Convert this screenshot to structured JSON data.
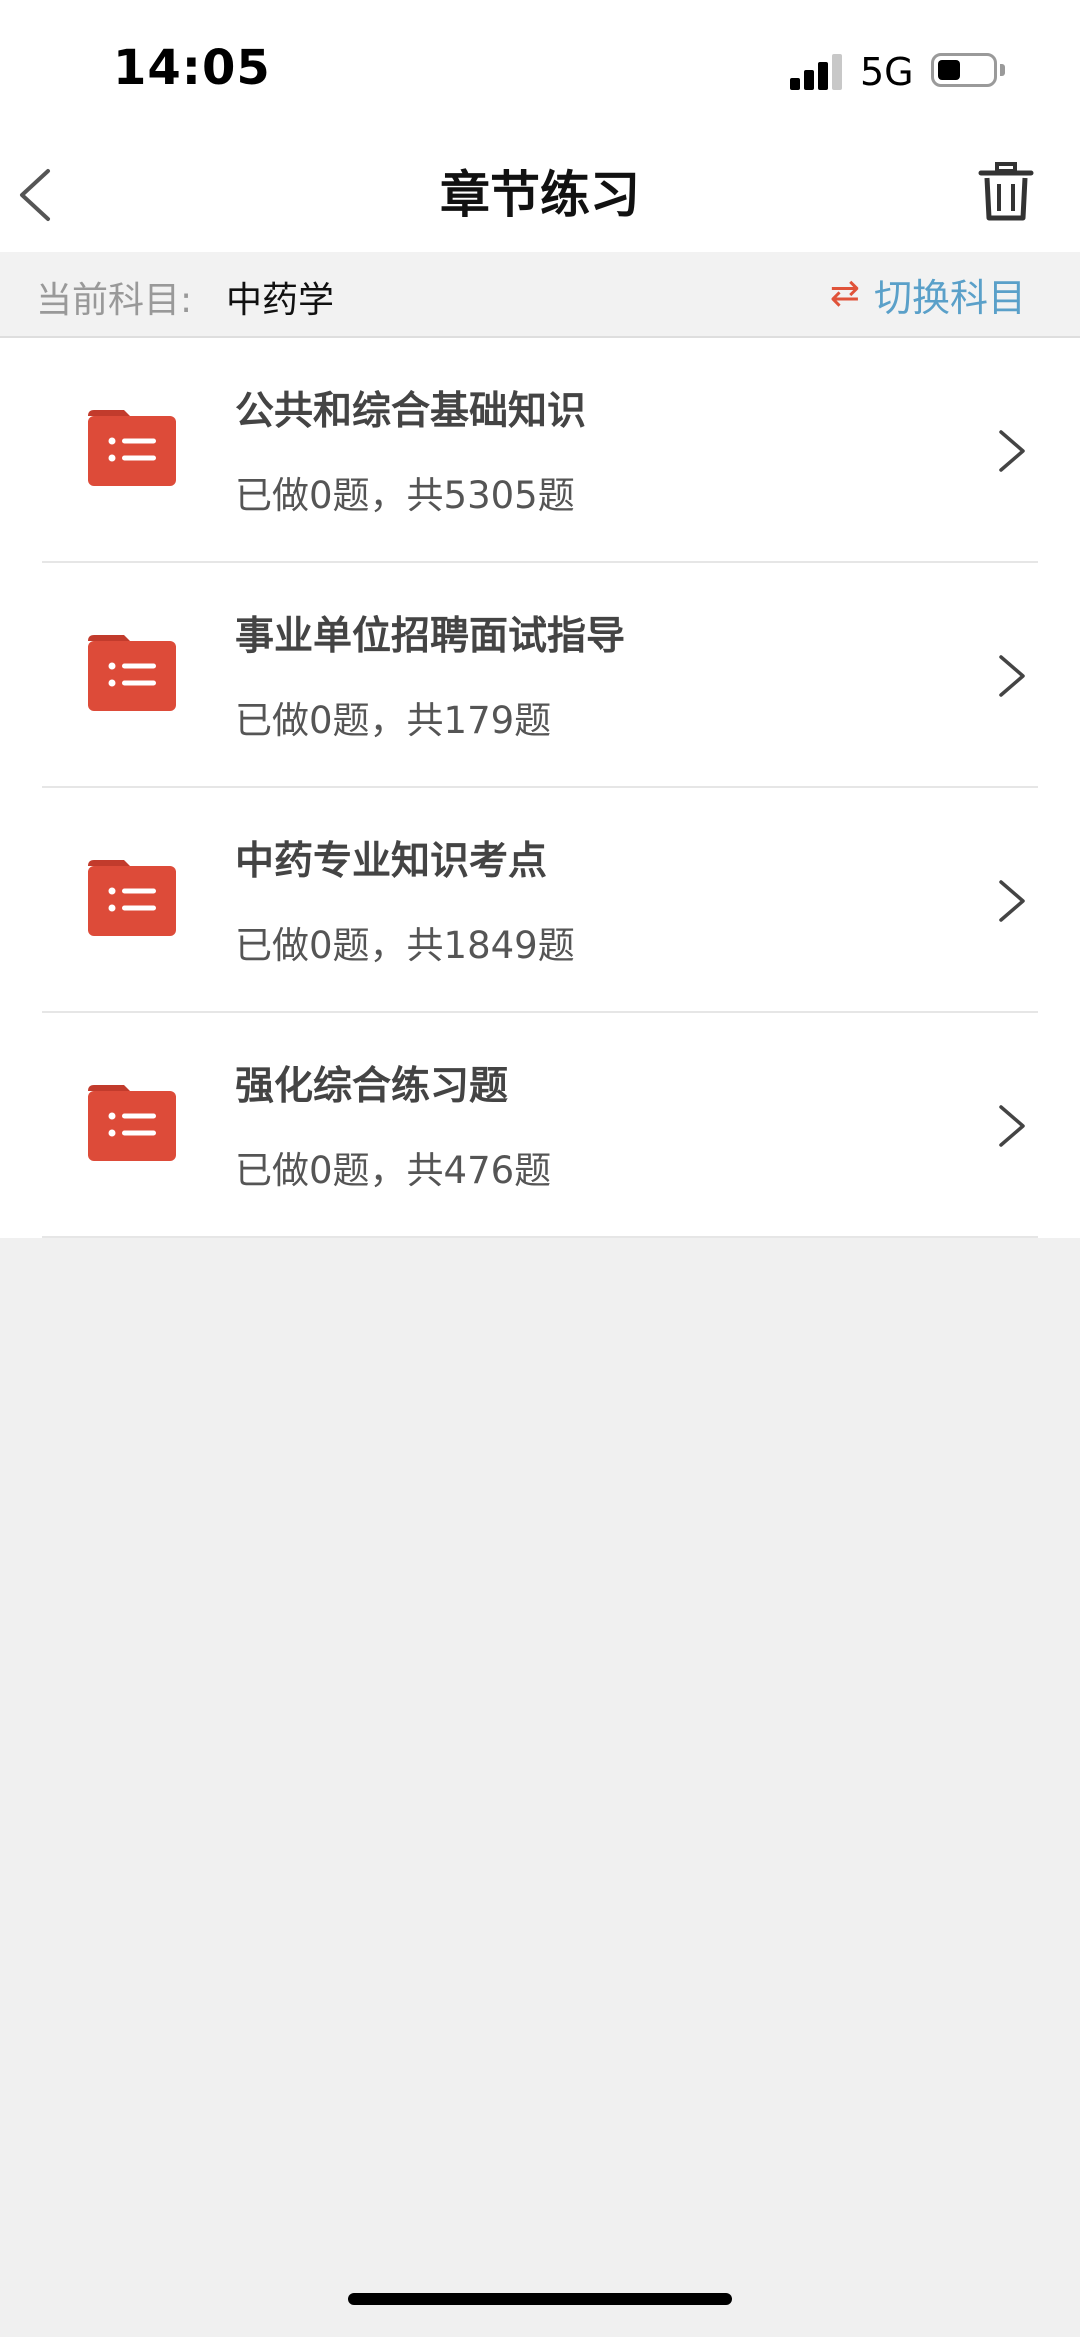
{
  "status_bar": {
    "time": "14:05",
    "network": "5G"
  },
  "nav": {
    "title": "章节练习",
    "back_icon": "chevron-left-icon",
    "trash_icon": "trash-icon"
  },
  "subject": {
    "label": "当前科目:",
    "value": "中药学",
    "switch_icon": "⇄",
    "switch_label": "切换科目"
  },
  "colors": {
    "folder": "#dd4b39",
    "switch_text": "#5aa0c9",
    "switch_icon": "#e0533a"
  },
  "chapters": [
    {
      "title": "公共和综合基础知识",
      "progress": "已做0题，共5305题"
    },
    {
      "title": "事业单位招聘面试指导",
      "progress": "已做0题，共179题"
    },
    {
      "title": "中药专业知识考点",
      "progress": "已做0题，共1849题"
    },
    {
      "title": "强化综合练习题",
      "progress": "已做0题，共476题"
    }
  ]
}
